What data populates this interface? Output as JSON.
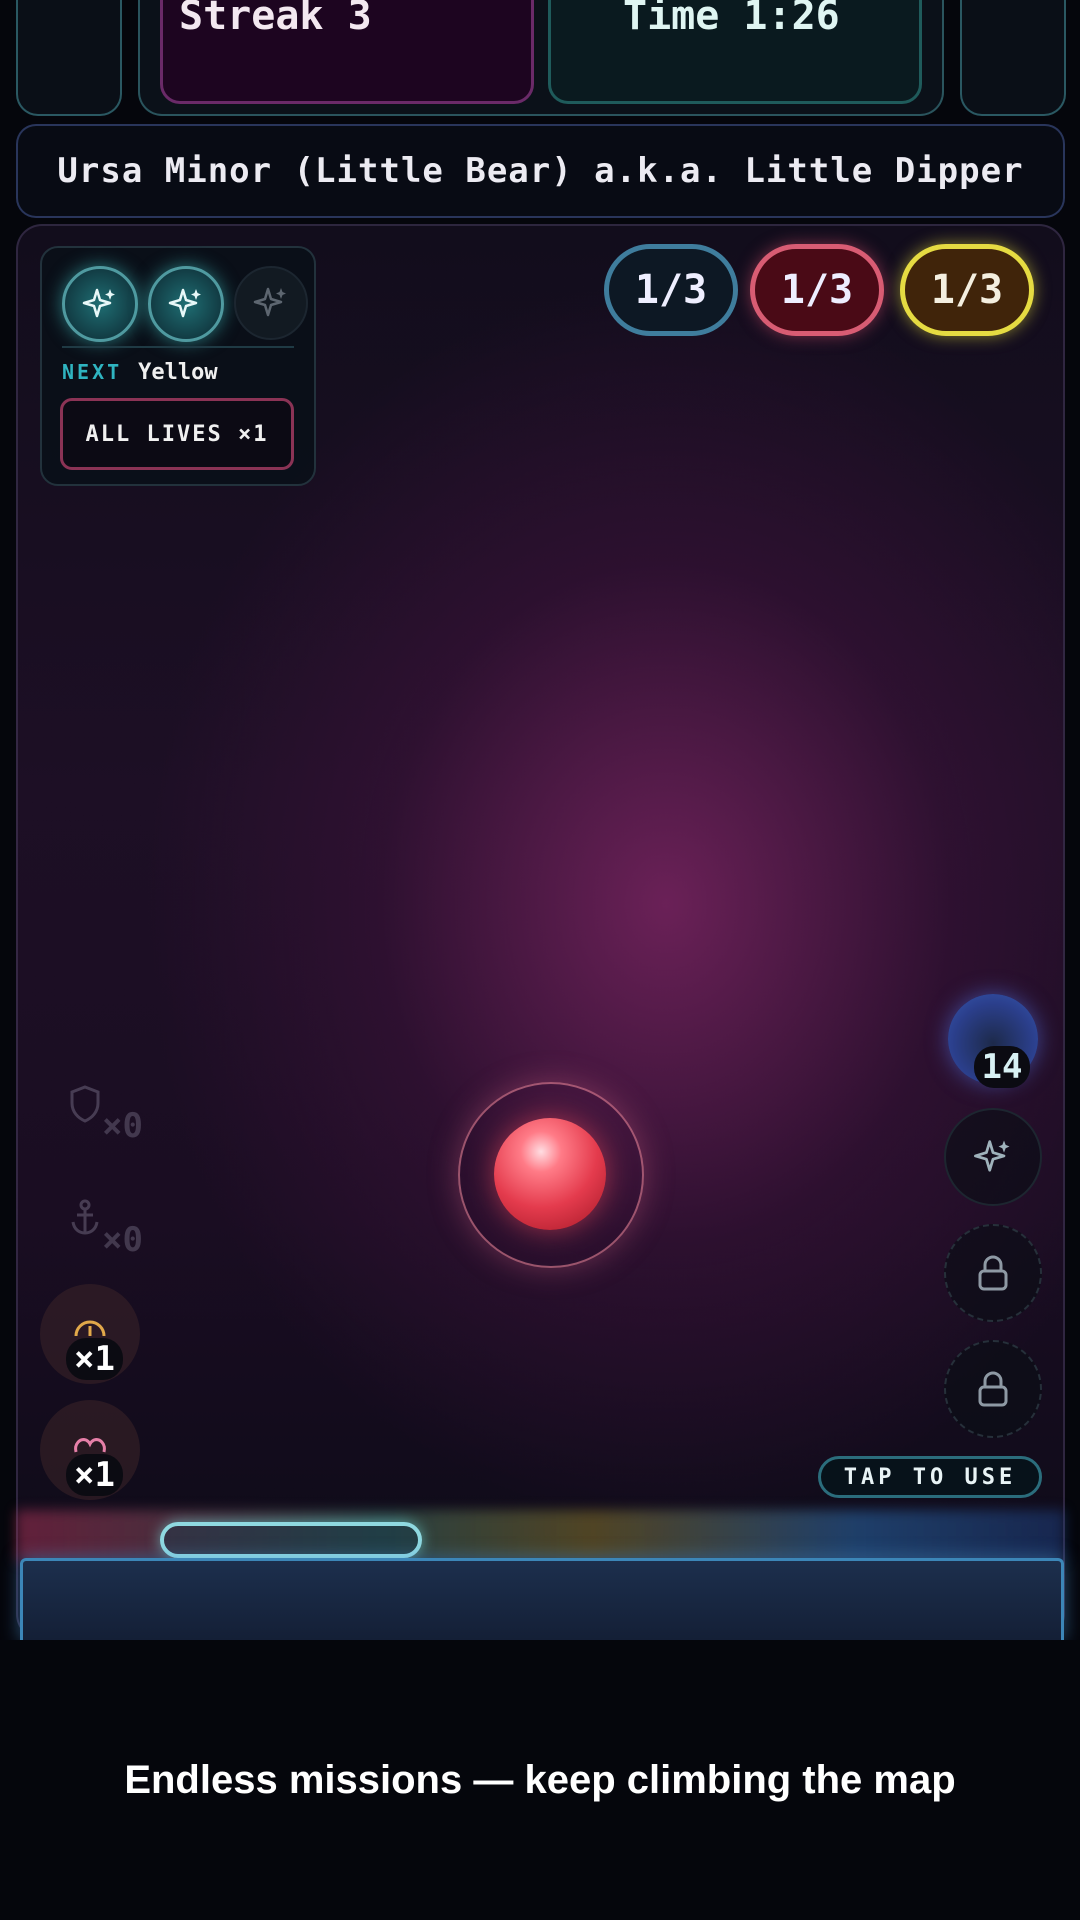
{
  "hud": {
    "streak_label": "Streak 3",
    "time_label": "Time 1:26",
    "corner_glyph": "+"
  },
  "level": {
    "title": "Ursa Minor (Little Bear) a.k.a. Little Dipper"
  },
  "powers": {
    "slots": [
      "sparkle-icon",
      "sparkle-icon",
      "sparkle-icon"
    ],
    "slots_active": [
      true,
      true,
      false
    ],
    "next_label": "NEXT",
    "next_value": "Yellow",
    "all_lives_label": "ALL LIVES ×1"
  },
  "counters": [
    {
      "label": "1/3",
      "color": "#3f7d9d"
    },
    {
      "label": "1/3",
      "color": "#d85c73"
    },
    {
      "label": "1/3",
      "color": "#e5db42"
    }
  ],
  "left_items": [
    {
      "icon": "shield-icon",
      "count": "×0",
      "available": false
    },
    {
      "icon": "anchor-icon",
      "count": "×0",
      "available": false
    },
    {
      "icon": "timer-icon",
      "count": "×1",
      "available": true
    },
    {
      "icon": "heart-icon",
      "count": "×1",
      "available": true
    }
  ],
  "right_items": {
    "portal_count": "14",
    "slots": [
      "sparkle-icon",
      "lock-icon",
      "lock-icon"
    ],
    "tap_label": "TAP TO USE"
  },
  "caption": "Endless missions — keep climbing the map",
  "colors": {
    "accent_teal": "#2fb4c0",
    "ball_red": "#e43b4d",
    "background": "#05060c"
  }
}
